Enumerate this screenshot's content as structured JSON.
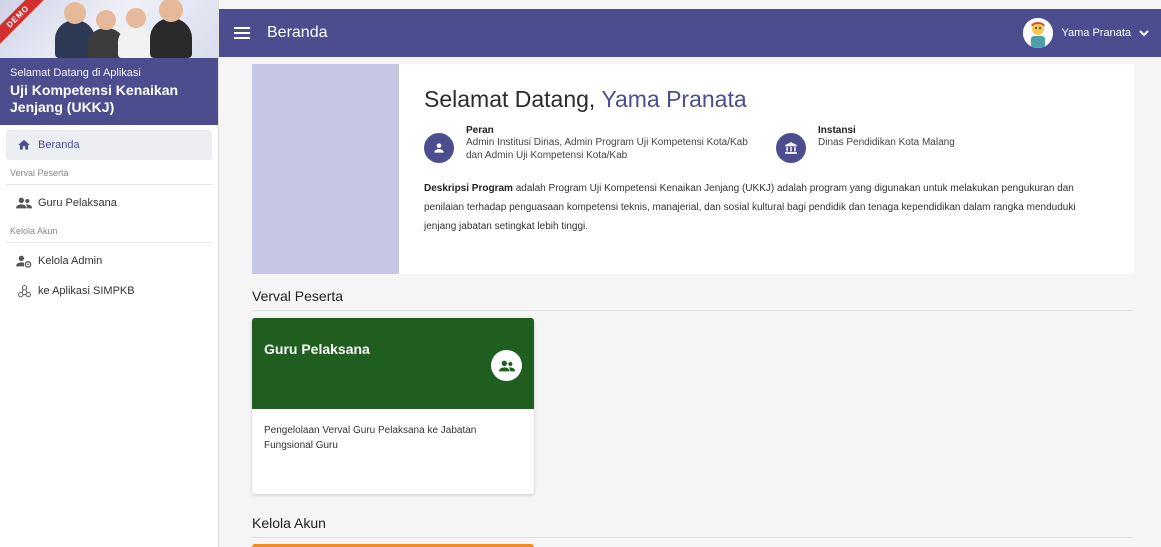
{
  "sidebar": {
    "demo_label": "DEMO",
    "welcome_small": "Selamat Datang di Aplikasi",
    "welcome_big": "Uji Kompetensi Kenaikan Jenjang (UKKJ)",
    "items": [
      {
        "label": "Beranda",
        "icon": "home-icon",
        "active": true
      },
      {
        "label": "Guru Pelaksana",
        "icon": "group-icon"
      },
      {
        "label": "Kelola Admin",
        "icon": "admin-settings-icon"
      },
      {
        "label": "ke Aplikasi SIMPKB",
        "icon": "hub-icon"
      }
    ],
    "sections": [
      "Verval Peserta",
      "Kelola Akun"
    ]
  },
  "header": {
    "title": "Beranda",
    "user_name": "Yama Pranata"
  },
  "welcome": {
    "greeting": "Selamat Datang,",
    "name": "Yama Pranata",
    "role_label": "Peran",
    "role_value": "Admin Institusi Dinas, Admin Program Uji Kompetensi Kota/Kab dan Admin Uji Kompetensi Kota/Kab",
    "institution_label": "Instansi",
    "institution_value": "Dinas Pendidikan Kota Malang",
    "desc_label": "Deskripsi Program",
    "desc_text": "adalah Program Uji Kompetensi Kenaikan Jenjang (UKKJ) adalah program yang digunakan untuk melakukan pengukuran dan penilaian terhadap penguasaan kompetensi teknis, manajerial, dan sosial kultural bagi pendidik dan tenaga kependidikan dalam rangka menduduki jenjang jabatan setingkat lebih tinggi."
  },
  "sections": {
    "verval": "Verval Peserta",
    "kelola": "Kelola Akun"
  },
  "cards": [
    {
      "title": "Guru Pelaksana",
      "description": "Pengelolaan Verval Guru Pelaksana ke Jabatan Fungsional Guru",
      "color": "#1f5e1f"
    }
  ],
  "colors": {
    "primary": "#4b4d8f",
    "card_green": "#1f5e1f",
    "next_card": "#f08a24"
  }
}
